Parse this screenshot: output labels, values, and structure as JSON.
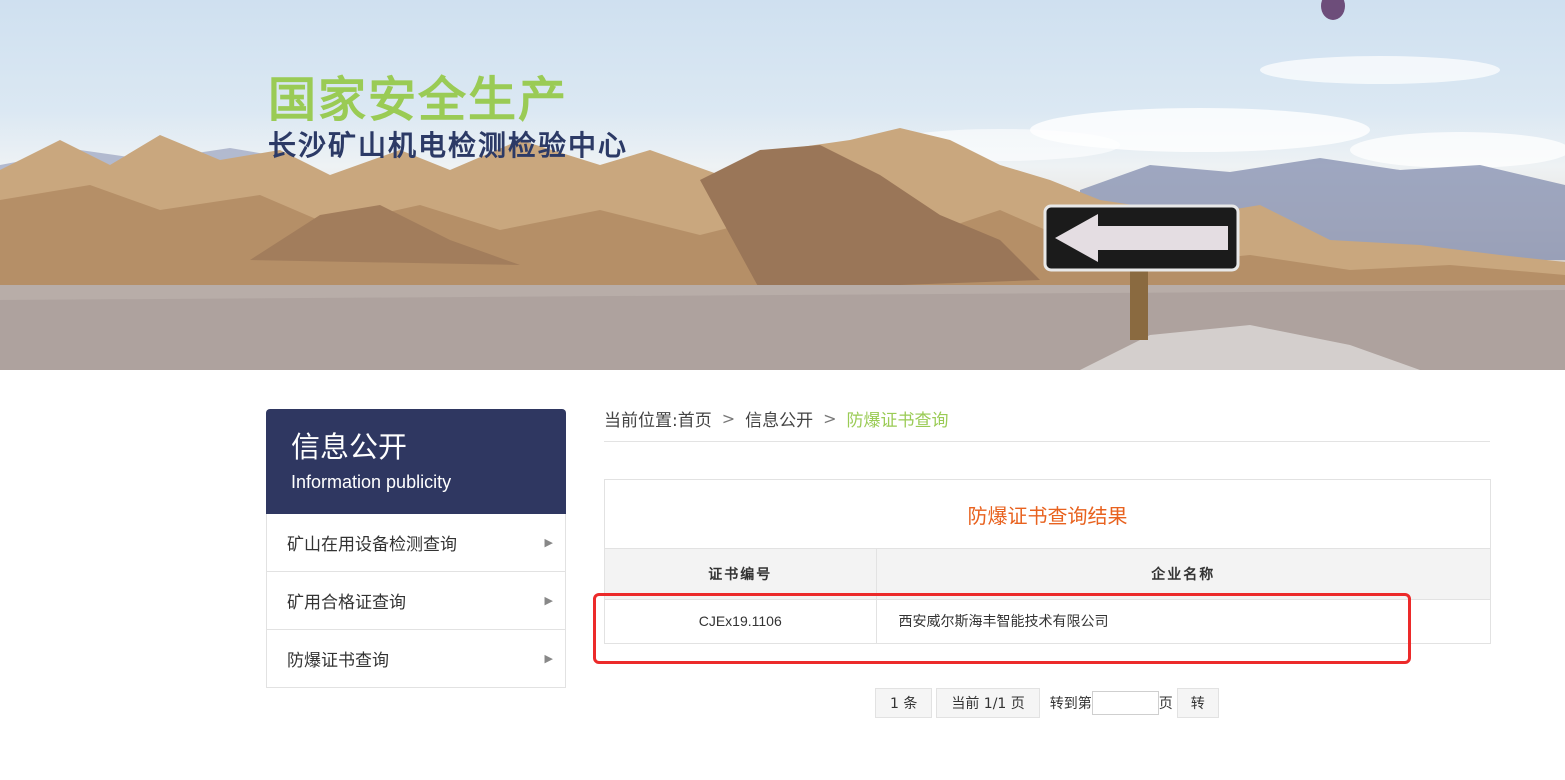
{
  "banner": {
    "title": "国家安全生产",
    "subtitle": "长沙矿山机电检测检验中心"
  },
  "sidebar": {
    "title_zh": "信息公开",
    "title_en": "Information publicity",
    "items": [
      {
        "label": "矿山在用设备检测查询"
      },
      {
        "label": "矿用合格证查询"
      },
      {
        "label": "防爆证书查询"
      }
    ]
  },
  "breadcrumb": {
    "prefix": "当前位置:",
    "home": "首页",
    "section": "信息公开",
    "current": "防爆证书查询",
    "separator": ">"
  },
  "result": {
    "title": "防爆证书查询结果",
    "columns": [
      "证书编号",
      "企业名称"
    ],
    "rows": [
      {
        "cert_no": "CJEx19.1106",
        "company": "西安威尔斯海丰智能技术有限公司"
      }
    ]
  },
  "pager": {
    "count": "1 条",
    "page_info": "当前 1/1 页",
    "goto_prefix": "转到第",
    "goto_value": "",
    "goto_suffix": "页",
    "go_label": "转"
  },
  "colors": {
    "accent_green": "#9acb55",
    "sidebar_navy": "#2f3761",
    "result_title_orange": "#e8621f",
    "highlight_red": "#ec2a2a"
  }
}
